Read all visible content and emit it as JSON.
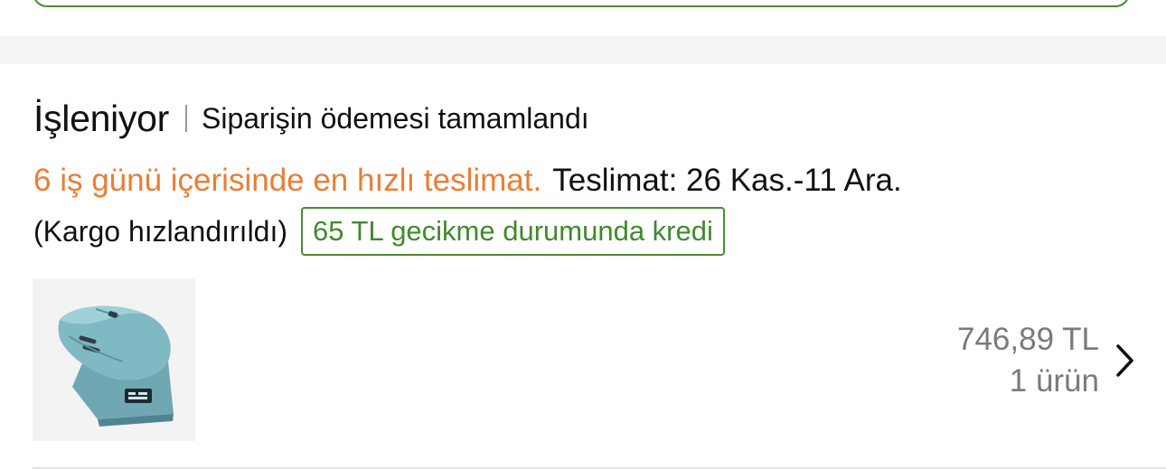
{
  "order": {
    "status_title": "İşleniyor",
    "status_desc": "Siparişin ödemesi tamamlandı",
    "delivery_promo": "6 iş günü içerisinde en hızlı teslimat.",
    "delivery_date": "Teslimat: 26 Kas.-11 Ara.",
    "shipping_note": "(Kargo hızlandırıldı)",
    "credit_badge": "65 TL gecikme durumunda kredi",
    "price": "746,89 TL",
    "item_count": "1 ürün",
    "product_image": "teal-wireless-mouse-on-charging-dock",
    "chevron_icon": "chevron-right-icon"
  },
  "colors": {
    "promo_orange": "#e87e35",
    "credit_green": "#3f8a2e",
    "price_gray": "#7a7a7a",
    "band_gray": "#f4f4f4"
  }
}
